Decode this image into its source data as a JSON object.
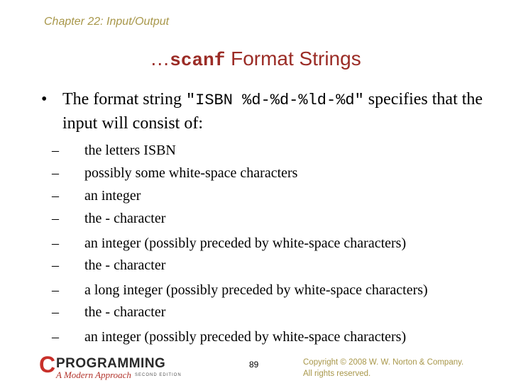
{
  "header": {
    "chapter": "Chapter 22: Input/Output"
  },
  "title": {
    "prefix": "…",
    "code": "scanf",
    "rest": " Format Strings"
  },
  "bullet": {
    "marker": "•",
    "text_before": "The format string ",
    "code": "\"ISBN %d-%d-%ld-%d\"",
    "text_after": " specifies that the input will consist of:"
  },
  "sub_items": [
    {
      "marker": "–",
      "text": "the letters ISBN"
    },
    {
      "marker": "–",
      "text": "possibly some white-space characters"
    },
    {
      "marker": "–",
      "text": "an integer"
    },
    {
      "marker": "–",
      "text": "the - character"
    },
    {
      "marker": "–",
      "text": "an integer (possibly preceded by white-space characters)"
    },
    {
      "marker": "–",
      "text": "the - character"
    },
    {
      "marker": "–",
      "text": "a long integer (possibly preceded by white-space characters)"
    },
    {
      "marker": "–",
      "text": "the - character"
    },
    {
      "marker": "–",
      "text": "an integer (possibly preceded by white-space characters)"
    }
  ],
  "footer": {
    "logo": {
      "letter": "C",
      "word": "PROGRAMMING",
      "subtitle": "A Modern Approach",
      "edition": "SECOND EDITION"
    },
    "page_number": "89",
    "copyright_line1": "Copyright © 2008 W. W. Norton & Company.",
    "copyright_line2": "All rights reserved."
  }
}
